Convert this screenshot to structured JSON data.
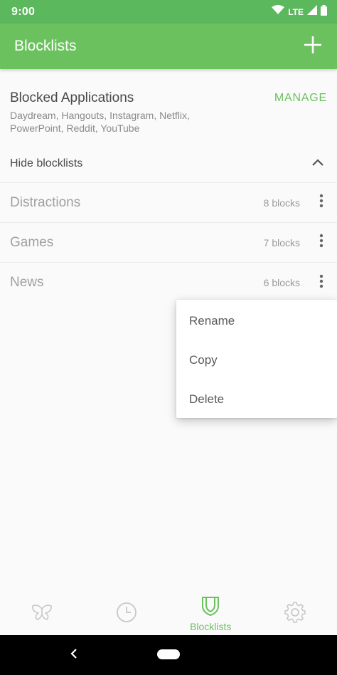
{
  "status_bar": {
    "time": "9:00",
    "network": "LTE",
    "icons": [
      "wifi-icon",
      "signal-icon",
      "battery-icon"
    ]
  },
  "app_bar": {
    "title": "Blocklists",
    "action_icon": "plus-icon"
  },
  "blocked_applications": {
    "title": "Blocked Applications",
    "apps": "Daydream, Hangouts, Instagram, Netflix, PowerPoint, Reddit, YouTube",
    "manage_label": "MANAGE"
  },
  "hide_blocklists": {
    "label": "Hide blocklists",
    "icon": "chevron-up-icon"
  },
  "blocklists": [
    {
      "name": "Distractions",
      "count": "8 blocks"
    },
    {
      "name": "Games",
      "count": "7 blocks"
    },
    {
      "name": "News",
      "count": "6 blocks"
    }
  ],
  "popup_menu": {
    "items": [
      "Rename",
      "Copy",
      "Delete"
    ]
  },
  "bottom_nav": {
    "items": [
      {
        "icon": "butterfly-icon",
        "label": ""
      },
      {
        "icon": "clock-icon",
        "label": ""
      },
      {
        "icon": "shield-icon",
        "label": "Blocklists",
        "active": true
      },
      {
        "icon": "gear-icon",
        "label": ""
      }
    ]
  },
  "colors": {
    "status_bar": "#5cb85c",
    "app_bar": "#6cc15f",
    "accent": "#6cc15f",
    "inactive_icon": "#c8c8c8"
  }
}
